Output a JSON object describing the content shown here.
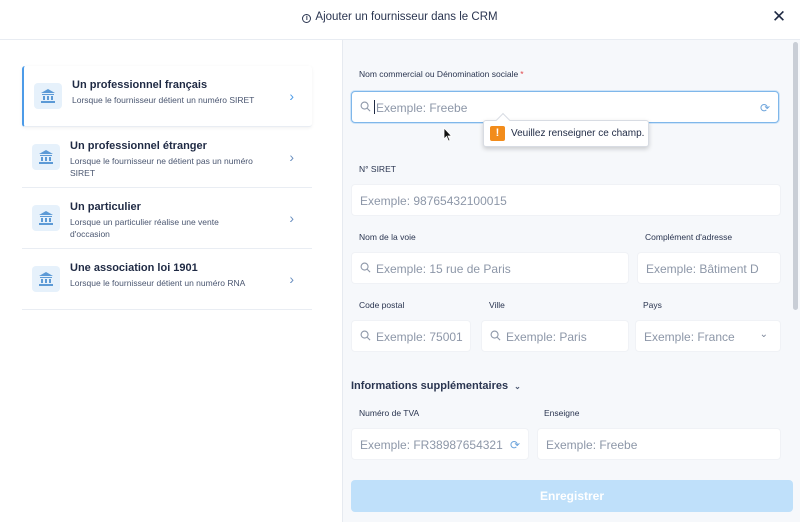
{
  "header": {
    "title": "Ajouter un fournisseur dans le CRM"
  },
  "types": [
    {
      "title": "Un professionnel français",
      "desc": "Lorsque le fournisseur détient un numéro SIRET"
    },
    {
      "title": "Un professionnel étranger",
      "desc": "Lorsque le fournisseur ne détient pas un numéro SIRET"
    },
    {
      "title": "Un particulier",
      "desc": "Lorsque un particulier réalise une vente d'occasion"
    },
    {
      "title": "Une association loi 1901",
      "desc": "Lorsque le fournisseur détient un numéro RNA"
    }
  ],
  "form": {
    "company_name": {
      "label": "Nom commercial ou Dénomination sociale",
      "required_mark": "*",
      "placeholder": "Exemple: Freebe"
    },
    "siret": {
      "label": "N° SIRET",
      "placeholder": "Exemple: 98765432100015"
    },
    "street": {
      "label": "Nom de la voie",
      "placeholder": "Exemple: 15 rue de Paris"
    },
    "address_complement": {
      "label": "Complément d'adresse",
      "placeholder": "Exemple: Bâtiment D"
    },
    "postal_code": {
      "label": "Code postal",
      "placeholder": "Exemple: 75001"
    },
    "city": {
      "label": "Ville",
      "placeholder": "Exemple: Paris"
    },
    "country": {
      "label": "Pays",
      "placeholder": "Exemple: France"
    },
    "extra_section": {
      "title": "Informations supplémentaires"
    },
    "vat": {
      "label": "Numéro de TVA",
      "placeholder": "Exemple: FR38987654321"
    },
    "brand": {
      "label": "Enseigne",
      "placeholder": "Exemple: Freebe"
    },
    "save_label": "Enregistrer"
  },
  "tooltip": {
    "message": "Veuillez renseigner ce champ."
  },
  "icons": {
    "close": "close-icon",
    "info": "info-icon",
    "bank": "bank-icon",
    "chevron": "chevron-right-icon",
    "search": "search-icon",
    "refresh": "refresh-icon",
    "warning": "warning-icon"
  },
  "colors": {
    "accent": "#4c9be8",
    "save_button": "#bfe0fa",
    "warning": "#f28c1b",
    "required": "#e0464a"
  }
}
